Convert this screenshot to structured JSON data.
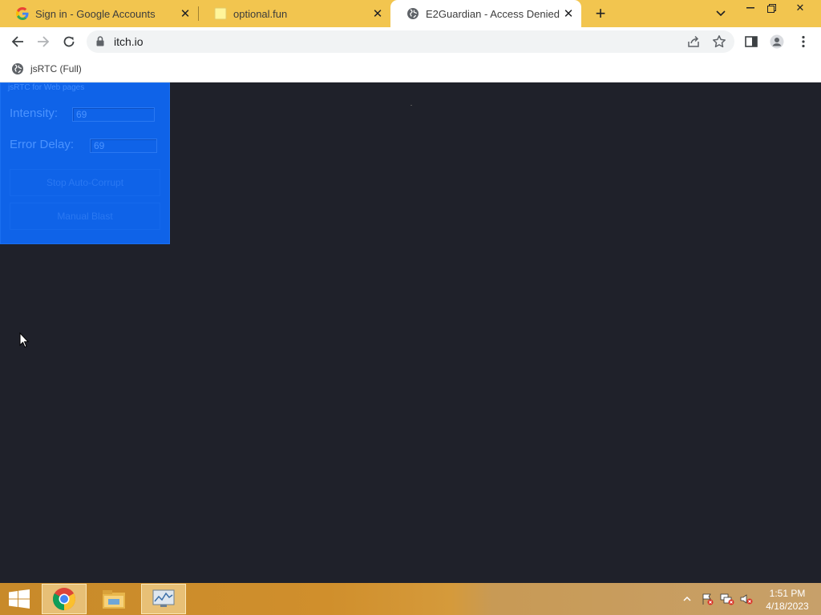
{
  "tabs": [
    {
      "title": "Sign in - Google Accounts",
      "favicon": "google-g-icon",
      "active": false
    },
    {
      "title": "optional.fun",
      "favicon": "blank-page-icon",
      "active": false
    },
    {
      "title": "E2Guardian - Access Denied",
      "favicon": "globe-icon",
      "active": true
    }
  ],
  "omnibox": {
    "url": "itch.io"
  },
  "bookmarks": [
    {
      "label": "jsRTC (Full)",
      "icon": "globe-icon"
    }
  ],
  "panel": {
    "title": "jsRTC for Web pages",
    "intensity_label": "Intensity:",
    "intensity_value": "69",
    "error_delay_label": "Error Delay:",
    "error_delay_value": "69",
    "stop_button": "Stop Auto-Corrupt",
    "manual_button": "Manual Blast"
  },
  "taskbar": {
    "time": "1:51 PM",
    "date": "4/18/2023"
  },
  "colors": {
    "tabstrip": "#f2c54f",
    "panel": "#0f63e8",
    "page_background": "#1f212a"
  }
}
